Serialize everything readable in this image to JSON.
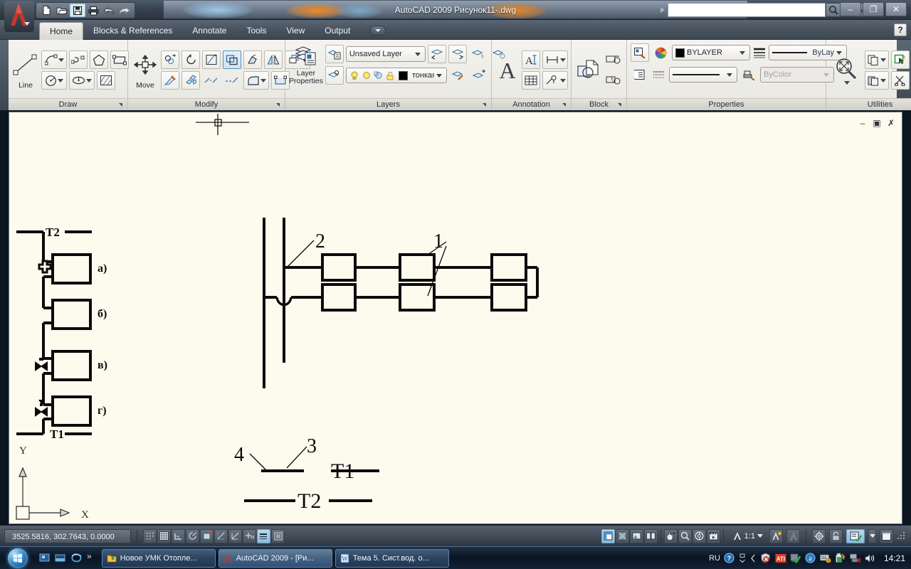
{
  "window": {
    "title": "AutoCAD 2009 Рисунок11-.dwg",
    "minimize_label": "–",
    "restore_label": "❐",
    "close_label": "✕",
    "help_label": "?",
    "doc_minimize": "–",
    "doc_restore": "▣",
    "doc_close": "✗"
  },
  "quick_access": {
    "items": [
      {
        "name": "new-file-icon",
        "label": "New"
      },
      {
        "name": "open-file-icon",
        "label": "Open"
      },
      {
        "name": "save-file-icon",
        "label": "Save"
      },
      {
        "name": "plot-icon",
        "label": "Plot"
      },
      {
        "name": "undo-icon",
        "label": "Undo"
      },
      {
        "name": "redo-icon",
        "label": "Redo"
      }
    ]
  },
  "search": {
    "value": "",
    "placeholder": ""
  },
  "ribbon": {
    "tabs": [
      {
        "label": "Home",
        "active": true
      },
      {
        "label": "Blocks & References",
        "active": false
      },
      {
        "label": "Annotate",
        "active": false
      },
      {
        "label": "Tools",
        "active": false
      },
      {
        "label": "View",
        "active": false
      },
      {
        "label": "Output",
        "active": false
      }
    ],
    "panels": [
      {
        "title": "Draw",
        "big_button": "Line"
      },
      {
        "title": "Modify",
        "big_button": "Move"
      },
      {
        "title": "Layers",
        "big_button_line1": "Layer",
        "big_button_line2": "Properties"
      },
      {
        "title": "Annotation",
        "big_button": "A"
      },
      {
        "title": "Block",
        "big_button": ""
      },
      {
        "title": "Properties",
        "big_button": ""
      },
      {
        "title": "Utilities",
        "big_button": ""
      }
    ],
    "layers": {
      "layer_combo_value": "Unsaved Layer",
      "current_layer_value": "тонкая"
    },
    "properties": {
      "color_value": "BYLAYER",
      "linetype_value": "ByLay",
      "lineweight_value": "",
      "plotstyle_value": "ByColor"
    }
  },
  "drawing": {
    "left_figure": {
      "top_pipe_label": "T2",
      "bottom_pipe_label": "T1",
      "items": [
        {
          "label": "а)"
        },
        {
          "label": "б)"
        },
        {
          "label": "в)"
        },
        {
          "label": "г)"
        }
      ]
    },
    "right_figure": {
      "callouts": [
        "1",
        "2",
        "3",
        "4"
      ],
      "supply_label": "T1",
      "return_label": "T2"
    },
    "ucs": {
      "x_label": "X",
      "y_label": "Y"
    }
  },
  "status_bar": {
    "coordinates": "3525.5816, 302.7643, 0.0000",
    "scale": "1:1",
    "left_toggles": [
      {
        "name": "snap-mode-toggle",
        "on": false
      },
      {
        "name": "grid-display-toggle",
        "on": false
      },
      {
        "name": "ortho-mode-toggle",
        "on": false
      },
      {
        "name": "polar-tracking-toggle",
        "on": false
      },
      {
        "name": "object-snap-toggle",
        "on": false
      },
      {
        "name": "object-snap-tracking-toggle",
        "on": false
      },
      {
        "name": "dynamic-ucs-toggle",
        "on": false
      },
      {
        "name": "dynamic-input-toggle",
        "on": true
      },
      {
        "name": "lineweight-display-toggle",
        "on": false
      }
    ],
    "right_toggles": [
      {
        "name": "model-layout-toggle",
        "on": true
      },
      {
        "name": "quick-view-layouts-icon",
        "on": false
      },
      {
        "name": "quick-view-drawings-icon",
        "on": false
      },
      {
        "name": "layout-tile-icon",
        "on": false
      },
      {
        "name": "pan-icon",
        "on": false
      },
      {
        "name": "zoom-icon",
        "on": false
      },
      {
        "name": "steering-wheel-icon",
        "on": false
      },
      {
        "name": "show-motion-icon",
        "on": false
      },
      {
        "name": "annotation-visibility-icon",
        "on": false
      },
      {
        "name": "annotation-scale-change-icon",
        "on": false
      },
      {
        "name": "workspace-settings-icon",
        "on": false
      },
      {
        "name": "toolbar-lock-icon",
        "on": false
      },
      {
        "name": "status-tray-settings-icon",
        "on": true
      },
      {
        "name": "clean-screen-icon",
        "on": false
      }
    ]
  },
  "taskbar": {
    "start_label": "Start",
    "quick_launch": [
      {
        "name": "show-desktop-icon"
      },
      {
        "name": "switch-window-icon"
      },
      {
        "name": "internet-explorer-icon"
      }
    ],
    "more_label": "»",
    "tasks": [
      {
        "label": "Новое УМК Отопле...",
        "icon": "folder-icon",
        "active": false
      },
      {
        "label": "AutoCAD 2009 - [Ри...",
        "icon": "autocad-icon",
        "active": true
      },
      {
        "label": "Тема 5. Сист.вод. о...",
        "icon": "word-doc-icon",
        "active": false
      }
    ],
    "tray": {
      "language": "RU",
      "icons": [
        {
          "name": "help-tray-icon"
        },
        {
          "name": "show-hidden-icons-icon"
        },
        {
          "name": "chevron-left-icon"
        },
        {
          "name": "security-alert-icon"
        },
        {
          "name": "ati-catalyst-icon"
        },
        {
          "name": "antivirus-shield-icon"
        },
        {
          "name": "agnitum-icon"
        },
        {
          "name": "keyboard-warning-icon"
        },
        {
          "name": "battery-icon"
        },
        {
          "name": "network-disconnected-icon"
        },
        {
          "name": "volume-icon"
        }
      ],
      "clock": "14:21"
    }
  },
  "colors": {
    "canvas_bg": "#fdfbee",
    "accent": "#8cbcdc",
    "title_text": "#fdfdfd",
    "autocad_red": "#c8372b"
  }
}
